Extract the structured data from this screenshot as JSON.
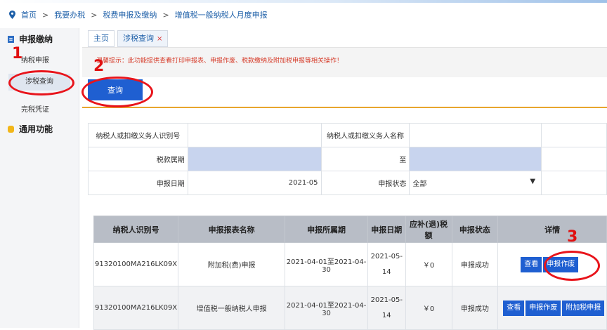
{
  "breadcrumb": {
    "items": [
      "首页",
      "我要办税",
      "税费申报及缴纳",
      "增值税一般纳税人月度申报"
    ],
    "separator": ">"
  },
  "sidebar": {
    "section1": "申报缴纳",
    "items": [
      "纳税申报",
      "涉税查询",
      "完税凭证"
    ],
    "section2": "通用功能"
  },
  "tabs": [
    {
      "label": "主页"
    },
    {
      "label": "涉税查询",
      "close": "×"
    }
  ],
  "hint": "温馨提示：此功能提供查看打印申报表、申报作废、税款缴纳及附加税申报等相关操作！",
  "query_button": "查询",
  "form": {
    "taxpayer_id_label": "纳税人或扣缴义务人识别号",
    "taxpayer_id_value": "",
    "taxpayer_name_label": "纳税人或扣缴义务人名称",
    "taxpayer_name_value": "",
    "period_label": "税款属期",
    "period_from": "",
    "to_label": "至",
    "period_to": "",
    "date_label": "申报日期",
    "date_value": "2021-05",
    "status_label": "申报状态",
    "status_value": "全部"
  },
  "table": {
    "headers": [
      "纳税人识别号",
      "申报报表名称",
      "申报所属期",
      "申报日期",
      "应补(退)税额",
      "申报状态",
      "详情"
    ],
    "rows": [
      {
        "id": "91320100MA216LK09X",
        "name": "附加税(费)申报",
        "period": "2021-04-01至2021-04-30",
        "date_line1": "2021-05-",
        "date_line2": "14",
        "amount": "￥0",
        "status": "申报成功",
        "actions": [
          "查看",
          "申报作废"
        ]
      },
      {
        "id": "91320100MA216LK09X",
        "name": "增值税一般纳税人申报",
        "period": "2021-04-01至2021-04-30",
        "date_line1": "2021-05-",
        "date_line2": "14",
        "amount": "￥0",
        "status": "申报成功",
        "actions": [
          "查看",
          "申报作废",
          "附加税申报"
        ]
      }
    ]
  },
  "annotations": [
    "1",
    "2",
    "3"
  ],
  "colors": {
    "primary": "#1f5fd1",
    "hint_red": "#d63c2a",
    "annotation_red": "#e8141b",
    "accent_gold": "#e8a62d"
  }
}
